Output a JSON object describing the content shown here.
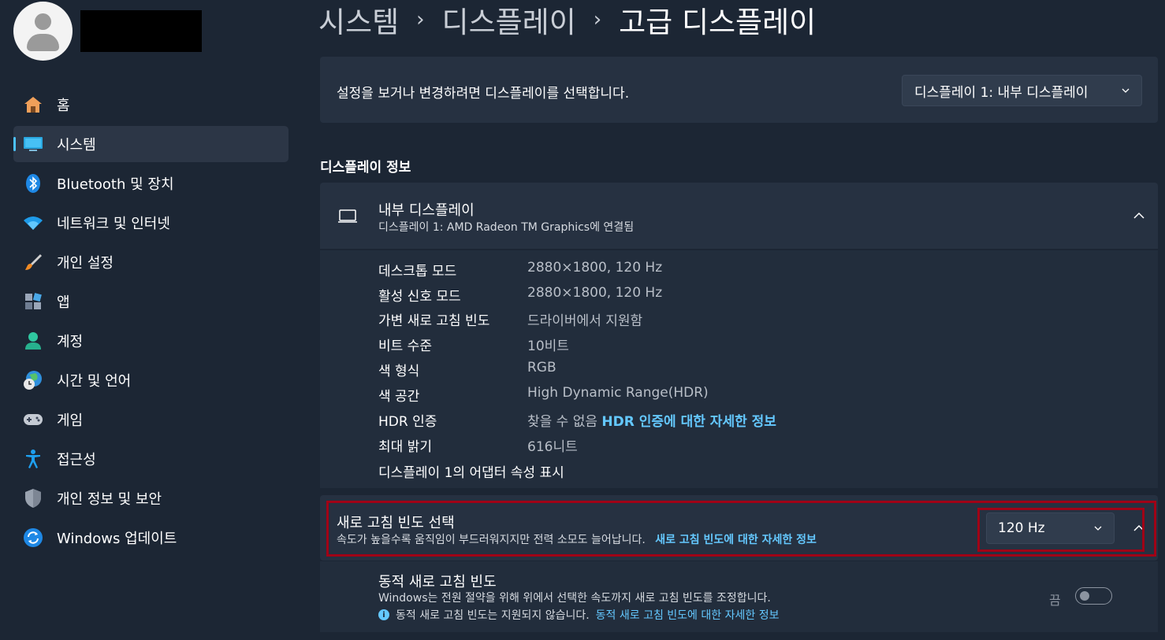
{
  "breadcrumb": {
    "level1": "시스템",
    "sep": "›",
    "level2": "디스플레이",
    "current": "고급 디스플레이"
  },
  "sidebar": {
    "items": [
      {
        "label": "홈",
        "icon": "home-icon"
      },
      {
        "label": "시스템",
        "icon": "system-icon",
        "active": true
      },
      {
        "label": "Bluetooth 및 장치",
        "icon": "bluetooth-icon"
      },
      {
        "label": "네트워크 및 인터넷",
        "icon": "wifi-icon"
      },
      {
        "label": "개인 설정",
        "icon": "brush-icon"
      },
      {
        "label": "앱",
        "icon": "apps-icon"
      },
      {
        "label": "계정",
        "icon": "account-icon"
      },
      {
        "label": "시간 및 언어",
        "icon": "globe-clock-icon"
      },
      {
        "label": "게임",
        "icon": "gamepad-icon"
      },
      {
        "label": "접근성",
        "icon": "accessibility-icon"
      },
      {
        "label": "개인 정보 및 보안",
        "icon": "shield-icon"
      },
      {
        "label": "Windows 업데이트",
        "icon": "update-icon"
      }
    ]
  },
  "select_display": {
    "label": "설정을 보거나 변경하려면 디스플레이를 선택합니다.",
    "selected": "디스플레이 1: 내부 디스플레이"
  },
  "display_info": {
    "section_title": "디스플레이 정보",
    "name": "내부 디스플레이",
    "subtitle": "디스플레이 1: AMD Radeon TM Graphics에 연결됨",
    "rows": [
      {
        "key": "데스크톱 모드",
        "value": "2880×1800, 120 Hz"
      },
      {
        "key": "활성 신호 모드",
        "value": "2880×1800, 120 Hz"
      },
      {
        "key": "가변 새로 고침 빈도",
        "value": "드라이버에서 지원함"
      },
      {
        "key": "비트 수준",
        "value": "10비트"
      },
      {
        "key": "색 형식",
        "value": "RGB"
      },
      {
        "key": "색 공간",
        "value": "High Dynamic Range(HDR)"
      },
      {
        "key": "HDR 인증",
        "value": "찾을 수 없음"
      },
      {
        "key": "최대 밝기",
        "value": "616니트"
      }
    ],
    "hdr_link": "HDR 인증에 대한 자세한 정보",
    "adapter_link": "디스플레이 1의 어댑터 속성 표시"
  },
  "refresh_rate": {
    "title": "새로 고침 빈도 선택",
    "description": "속도가 높을수록 움직임이 부드러워지지만 전력 소모도 늘어납니다.",
    "link": "새로 고침 빈도에 대한 자세한 정보",
    "selected": "120 Hz"
  },
  "dynamic_refresh": {
    "title": "동적 새로 고침 빈도",
    "description": "Windows는 전원 절약을 위해 위에서 선택한 속도까지 새로 고침 빈도를 조정합니다.",
    "notice": "동적 새로 고침 빈도는 지원되지 않습니다.",
    "link": "동적 새로 고침 빈도에 대한 자세한 정보",
    "toggle_label": "끔",
    "toggle_on": false
  },
  "colors": {
    "accent": "#4cc2ff",
    "link": "#64c8ff",
    "highlight": "#a00016",
    "background": "#1c2634",
    "card": "#263141"
  }
}
